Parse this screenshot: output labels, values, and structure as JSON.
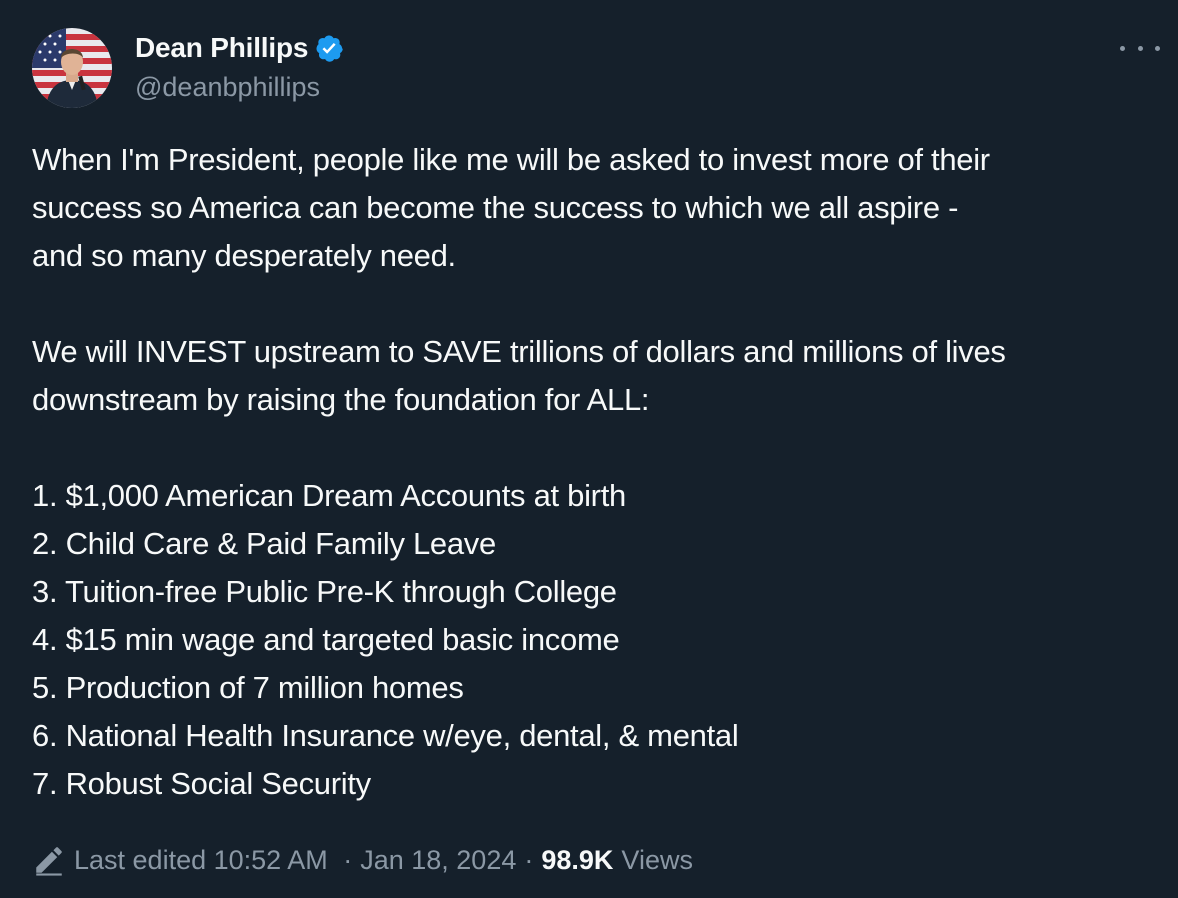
{
  "author": {
    "display_name": "Dean Phillips",
    "handle": "@deanbphillips",
    "verified": true,
    "avatar_icon": "user-avatar-flag",
    "verified_color": "#1d9bf0"
  },
  "menu": {
    "more_icon": "more-horizontal-icon"
  },
  "tweet": {
    "lines": [
      "When I'm President, people like me will be asked to invest more of their",
      "success so America can become the success to which we all aspire -",
      "and so many desperately need.",
      "",
      "We will INVEST upstream to SAVE trillions of dollars and millions of lives",
      "downstream by raising the foundation for ALL:",
      "",
      "1. $1,000 American Dream Accounts at birth",
      "2. Child Care & Paid Family Leave",
      "3. Tuition-free Public Pre-K through College",
      "4. $15 min wage and targeted basic income",
      "5. Production of 7 million homes",
      "6. National Health Insurance w/eye, dental, & mental",
      "7. Robust Social Security"
    ]
  },
  "footer": {
    "edited_label": "Last edited",
    "time": "10:52 AM",
    "separator": "·",
    "date": "Jan 18, 2024",
    "views_count": "98.9K",
    "views_label": "Views",
    "edit_icon": "pencil-icon"
  },
  "colors": {
    "background": "#15202b",
    "text_primary": "#f7f9f9",
    "text_secondary": "#8b98a5",
    "accent": "#1d9bf0"
  }
}
